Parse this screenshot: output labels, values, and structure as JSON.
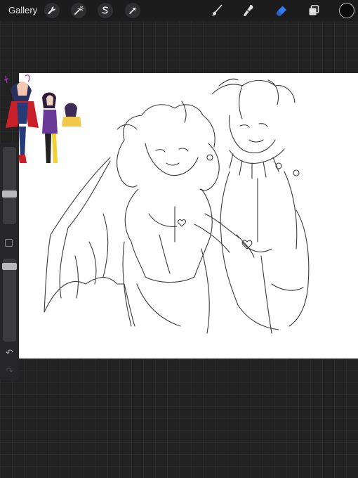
{
  "topbar": {
    "gallery_label": "Gallery",
    "left_tools": [
      "actions-wrench-icon",
      "adjustments-wand-icon",
      "selection-s-icon",
      "transform-arrow-icon"
    ],
    "right_tools": [
      "brush-icon",
      "smudge-icon",
      "eraser-icon",
      "layers-icon"
    ],
    "active_tool": "eraser-icon",
    "accent_color": "#2f7cf6",
    "current_color": "#0b0b0b"
  },
  "sidebar": {
    "brush_size_level": 0.3,
    "opacity_level": 0.02
  }
}
